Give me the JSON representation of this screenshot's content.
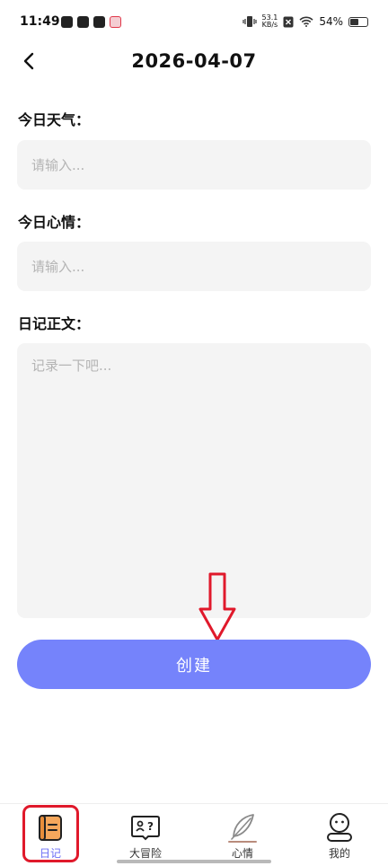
{
  "status_bar": {
    "time": "11:49",
    "net_speed_value": "53.1",
    "net_speed_unit": "KB/s",
    "battery_percent": "54%",
    "battery_level": 0.54
  },
  "header": {
    "title": "2026-04-07"
  },
  "form": {
    "weather_label": "今日天气：",
    "weather_placeholder": "请输入...",
    "weather_value": "",
    "mood_label": "今日心情：",
    "mood_placeholder": "请输入...",
    "mood_value": "",
    "body_label": "日记正文：",
    "body_placeholder": "记录一下吧...",
    "body_value": ""
  },
  "create_button_label": "创建",
  "tabs": [
    {
      "label": "日记",
      "icon": "diary-book-icon",
      "active": true
    },
    {
      "label": "大冒险",
      "icon": "adventure-card-icon",
      "active": false
    },
    {
      "label": "心情",
      "icon": "feather-icon",
      "active": false
    },
    {
      "label": "我的",
      "icon": "profile-face-icon",
      "active": false
    }
  ],
  "colors": {
    "accent": "#7583fb",
    "active_tab": "#6a6ef5",
    "annotation": "#e0192b",
    "input_bg": "#f4f4f4"
  }
}
